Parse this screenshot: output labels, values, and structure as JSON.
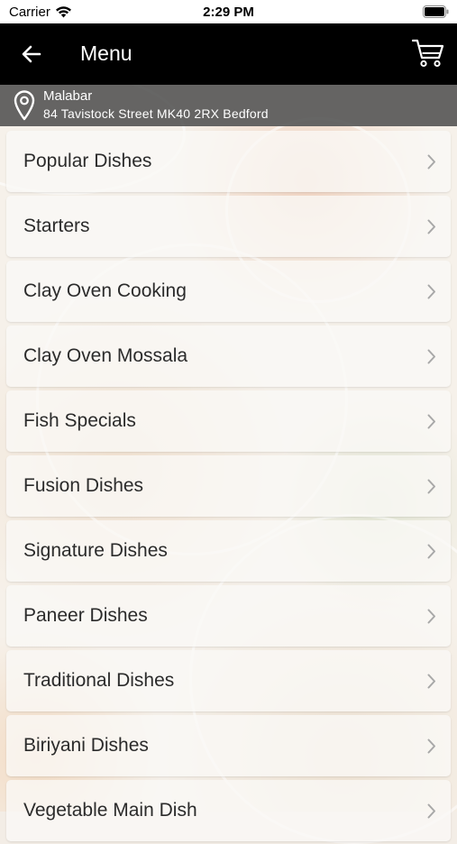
{
  "status_bar": {
    "carrier": "Carrier",
    "time": "2:29 PM"
  },
  "header": {
    "title": "Menu",
    "back_icon": "arrow-left-icon",
    "cart_icon": "shopping-cart-icon"
  },
  "location": {
    "name": "Malabar",
    "address": "84 Tavistock Street MK40 2RX Bedford",
    "icon": "map-pin-icon"
  },
  "menu": {
    "items": [
      {
        "label": "Popular Dishes"
      },
      {
        "label": "Starters"
      },
      {
        "label": "Clay Oven Cooking"
      },
      {
        "label": "Clay Oven Mossala"
      },
      {
        "label": "Fish Specials"
      },
      {
        "label": "Fusion Dishes"
      },
      {
        "label": "Signature Dishes"
      },
      {
        "label": "Paneer Dishes"
      },
      {
        "label": "Traditional Dishes"
      },
      {
        "label": "Biriyani Dishes"
      },
      {
        "label": "Vegetable Main Dish"
      }
    ]
  },
  "colors": {
    "nav_background": "#000000",
    "location_background": "#464646",
    "item_text": "#2b2b2b"
  }
}
